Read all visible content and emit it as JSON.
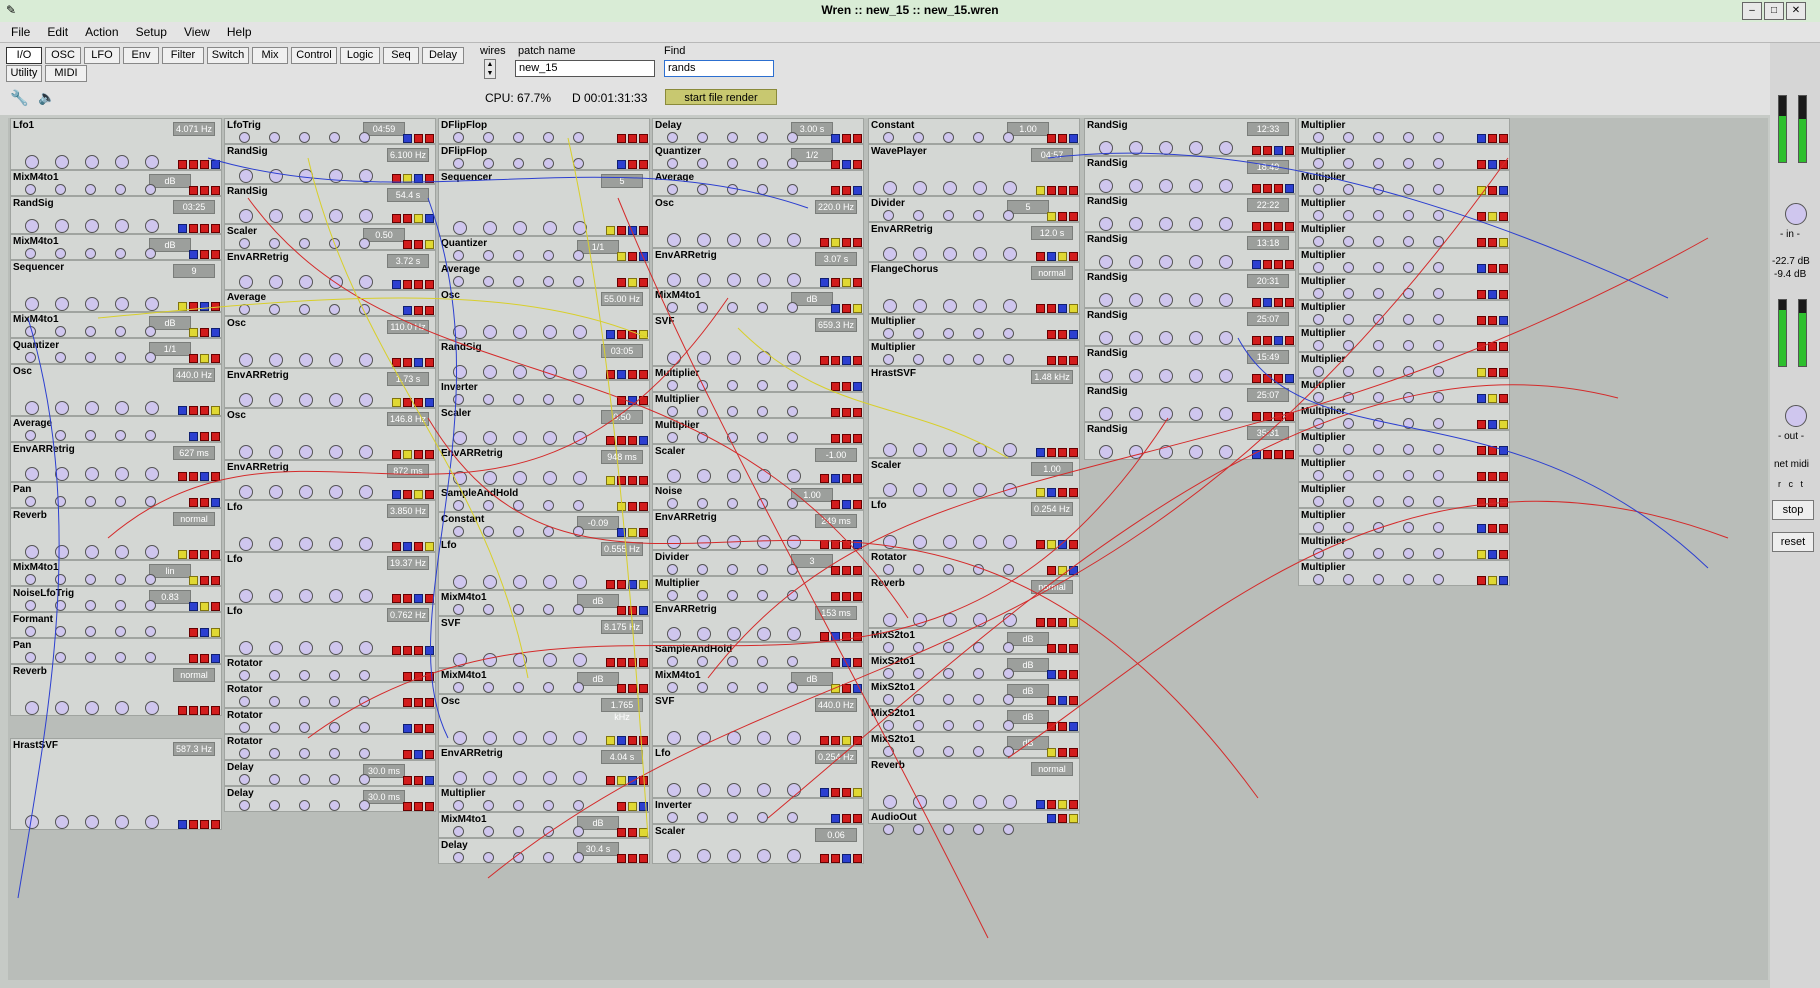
{
  "window": {
    "title": "Wren :: new_15 :: new_15.wren"
  },
  "menu": [
    "File",
    "Edit",
    "Action",
    "Setup",
    "View",
    "Help"
  ],
  "tabs_row1": [
    "I/O",
    "OSC",
    "LFO",
    "Env",
    "Filter",
    "Switch",
    "Mix",
    "Control",
    "Logic",
    "Seq",
    "Delay"
  ],
  "tabs_row2": [
    "Utility",
    "MIDI"
  ],
  "wires_label": "wires",
  "patch": {
    "label": "patch name",
    "value": "new_15"
  },
  "find": {
    "label": "Find",
    "value": "rands"
  },
  "status": {
    "cpu": "CPU: 67.7%",
    "time": "D 00:01:31:33"
  },
  "render_button": "start file render",
  "side": {
    "in_label": "- in -",
    "level1": "-22.7 dB",
    "level2": "-9.4 dB",
    "out_label": "- out -",
    "midi_label": "net midi",
    "midi_cols": "r   c   t",
    "stop": "stop",
    "reset": "reset"
  },
  "modules": [
    {
      "id": "m1",
      "name": "Lfo1",
      "disp": "4.071 Hz"
    },
    {
      "id": "m2",
      "name": "MixM4to1",
      "disp": "dB"
    },
    {
      "id": "m3",
      "name": "RandSig",
      "disp": "03:25"
    },
    {
      "id": "m4",
      "name": "MixM4to1",
      "disp": "dB"
    },
    {
      "id": "m5",
      "name": "Sequencer",
      "disp": "9"
    },
    {
      "id": "m6",
      "name": "MixM4to1",
      "disp": "dB"
    },
    {
      "id": "m7",
      "name": "Quantizer",
      "disp": "1/1"
    },
    {
      "id": "m8",
      "name": "Osc",
      "disp": "440.0 Hz"
    },
    {
      "id": "m9",
      "name": "Average",
      "disp": ""
    },
    {
      "id": "m10",
      "name": "EnvARRetrig",
      "disp": "627 ms"
    },
    {
      "id": "m11",
      "name": "Pan",
      "disp": ""
    },
    {
      "id": "m12",
      "name": "Reverb",
      "disp": "normal"
    },
    {
      "id": "m13",
      "name": "MixM4to1",
      "disp": "lin"
    },
    {
      "id": "m14",
      "name": "NoiseLfoTrig",
      "disp": "0.83"
    },
    {
      "id": "m15",
      "name": "Formant",
      "disp": ""
    },
    {
      "id": "m16",
      "name": "Pan",
      "disp": ""
    },
    {
      "id": "m17",
      "name": "Reverb",
      "disp": "normal"
    },
    {
      "id": "m18",
      "name": "HrastSVF",
      "disp": "587.3 Hz"
    },
    {
      "id": "c2a",
      "name": "LfoTrig",
      "disp": "04:59"
    },
    {
      "id": "c2b",
      "name": "RandSig",
      "disp": "6.100 Hz"
    },
    {
      "id": "c2c",
      "name": "RandSig",
      "disp": "54.4 s"
    },
    {
      "id": "c2d",
      "name": "Scaler",
      "disp": "0.50"
    },
    {
      "id": "c2e",
      "name": "EnvARRetrig",
      "disp": "3.72 s"
    },
    {
      "id": "c2f",
      "name": "Average",
      "disp": ""
    },
    {
      "id": "c2g",
      "name": "Osc",
      "disp": "110.0 Hz"
    },
    {
      "id": "c2h",
      "name": "EnvARRetrig",
      "disp": "1.73 s"
    },
    {
      "id": "c2i",
      "name": "Osc",
      "disp": "146.8 Hz"
    },
    {
      "id": "c2j",
      "name": "EnvARRetrig",
      "disp": "872 ms"
    },
    {
      "id": "c2k",
      "name": "Lfo",
      "disp": "3.850 Hz"
    },
    {
      "id": "c2l",
      "name": "Lfo",
      "disp": "19.37 Hz"
    },
    {
      "id": "c2m",
      "name": "Lfo",
      "disp": "0.762 Hz"
    },
    {
      "id": "c2n",
      "name": "Rotator",
      "disp": ""
    },
    {
      "id": "c2o",
      "name": "Rotator",
      "disp": ""
    },
    {
      "id": "c2p",
      "name": "Rotator",
      "disp": ""
    },
    {
      "id": "c2q",
      "name": "Rotator",
      "disp": ""
    },
    {
      "id": "c2r",
      "name": "Delay",
      "disp": "30.0 ms"
    },
    {
      "id": "c2s",
      "name": "Delay",
      "disp": "30.0 ms"
    },
    {
      "id": "c3a",
      "name": "DFlipFlop",
      "disp": ""
    },
    {
      "id": "c3b",
      "name": "DFlipFlop",
      "disp": ""
    },
    {
      "id": "c3c",
      "name": "Sequencer",
      "disp": "5"
    },
    {
      "id": "c3d",
      "name": "Quantizer",
      "disp": "1/1"
    },
    {
      "id": "c3e",
      "name": "Average",
      "disp": ""
    },
    {
      "id": "c3f",
      "name": "Osc",
      "disp": "55.00 Hz"
    },
    {
      "id": "c3g",
      "name": "RandSig",
      "disp": "03:05"
    },
    {
      "id": "c3h",
      "name": "Inverter",
      "disp": ""
    },
    {
      "id": "c3i",
      "name": "Scaler",
      "disp": "0.50"
    },
    {
      "id": "c3j",
      "name": "EnvARRetrig",
      "disp": "948 ms"
    },
    {
      "id": "c3k",
      "name": "SampleAndHold",
      "disp": ""
    },
    {
      "id": "c3l",
      "name": "Constant",
      "disp": "-0.09"
    },
    {
      "id": "c3m",
      "name": "Lfo",
      "disp": "0.555 Hz"
    },
    {
      "id": "c3n",
      "name": "MixM4to1",
      "disp": "dB"
    },
    {
      "id": "c3o",
      "name": "SVF",
      "disp": "8.175 Hz"
    },
    {
      "id": "c3p",
      "name": "MixM4to1",
      "disp": "dB"
    },
    {
      "id": "c3q",
      "name": "Osc",
      "disp": "1.765 kHz"
    },
    {
      "id": "c3r",
      "name": "EnvARRetrig",
      "disp": "4.04 s"
    },
    {
      "id": "c3s",
      "name": "Multiplier",
      "disp": ""
    },
    {
      "id": "c3t",
      "name": "MixM4to1",
      "disp": "dB"
    },
    {
      "id": "c3u",
      "name": "Delay",
      "disp": "30.4 s"
    },
    {
      "id": "c4a",
      "name": "Delay",
      "disp": "3.00 s"
    },
    {
      "id": "c4b",
      "name": "Quantizer",
      "disp": "1/2"
    },
    {
      "id": "c4c",
      "name": "Average",
      "disp": ""
    },
    {
      "id": "c4d",
      "name": "Osc",
      "disp": "220.0 Hz"
    },
    {
      "id": "c4e",
      "name": "EnvARRetrig",
      "disp": "3.07 s"
    },
    {
      "id": "c4f",
      "name": "MixM4to1",
      "disp": "dB"
    },
    {
      "id": "c4g",
      "name": "SVF",
      "disp": "659.3 Hz"
    },
    {
      "id": "c4h",
      "name": "Multiplier",
      "disp": ""
    },
    {
      "id": "c4i",
      "name": "Multiplier",
      "disp": ""
    },
    {
      "id": "c4j",
      "name": "Multiplier",
      "disp": ""
    },
    {
      "id": "c4k",
      "name": "Scaler",
      "disp": "-1.00"
    },
    {
      "id": "c4l",
      "name": "Noise",
      "disp": "1.00"
    },
    {
      "id": "c4m",
      "name": "EnvARRetrig",
      "disp": "249 ms"
    },
    {
      "id": "c4n",
      "name": "Divider",
      "disp": "3"
    },
    {
      "id": "c4o",
      "name": "Multiplier",
      "disp": ""
    },
    {
      "id": "c4p",
      "name": "EnvARRetrig",
      "disp": "153 ms"
    },
    {
      "id": "c4q",
      "name": "SampleAndHold",
      "disp": ""
    },
    {
      "id": "c4r",
      "name": "MixM4to1",
      "disp": "dB"
    },
    {
      "id": "c4s",
      "name": "SVF",
      "disp": "440.0 Hz"
    },
    {
      "id": "c4t",
      "name": "Lfo",
      "disp": "0.254 Hz"
    },
    {
      "id": "c4u",
      "name": "Inverter",
      "disp": ""
    },
    {
      "id": "c4v",
      "name": "Scaler",
      "disp": "0.06"
    },
    {
      "id": "c5a",
      "name": "Constant",
      "disp": "1.00"
    },
    {
      "id": "c5b",
      "name": "WavePlayer",
      "disp": "04:57"
    },
    {
      "id": "c5c",
      "name": "Divider",
      "disp": "5"
    },
    {
      "id": "c5d",
      "name": "EnvARRetrig",
      "disp": "12.0 s"
    },
    {
      "id": "c5e",
      "name": "FlangeChorus",
      "disp": "normal"
    },
    {
      "id": "c5f",
      "name": "Multiplier",
      "disp": ""
    },
    {
      "id": "c5g",
      "name": "Multiplier",
      "disp": ""
    },
    {
      "id": "c5h",
      "name": "HrastSVF",
      "disp": "1.48 kHz"
    },
    {
      "id": "c5i",
      "name": "Scaler",
      "disp": "1.00"
    },
    {
      "id": "c5j",
      "name": "Lfo",
      "disp": "0.254 Hz"
    },
    {
      "id": "c5k",
      "name": "Rotator",
      "disp": ""
    },
    {
      "id": "c5l",
      "name": "Reverb",
      "disp": "normal"
    },
    {
      "id": "c5m",
      "name": "MixS2to1",
      "disp": "dB"
    },
    {
      "id": "c5n",
      "name": "MixS2to1",
      "disp": "dB"
    },
    {
      "id": "c5o",
      "name": "MixS2to1",
      "disp": "dB"
    },
    {
      "id": "c5p",
      "name": "MixS2to1",
      "disp": "dB"
    },
    {
      "id": "c5q",
      "name": "MixS2to1",
      "disp": "dB"
    },
    {
      "id": "c5r",
      "name": "Reverb",
      "disp": "normal"
    },
    {
      "id": "c5s",
      "name": "AudioOut",
      "disp": ""
    },
    {
      "id": "c6a",
      "name": "RandSig",
      "disp": "12:33"
    },
    {
      "id": "c6b",
      "name": "RandSig",
      "disp": "18:49"
    },
    {
      "id": "c6c",
      "name": "RandSig",
      "disp": "22:22"
    },
    {
      "id": "c6d",
      "name": "RandSig",
      "disp": "13:18"
    },
    {
      "id": "c6e",
      "name": "RandSig",
      "disp": "20:31"
    },
    {
      "id": "c6f",
      "name": "RandSig",
      "disp": "25:07"
    },
    {
      "id": "c6g",
      "name": "RandSig",
      "disp": "15:49"
    },
    {
      "id": "c6h",
      "name": "RandSig",
      "disp": "25:07"
    },
    {
      "id": "c6i",
      "name": "RandSig",
      "disp": "35:31"
    },
    {
      "id": "c7a",
      "name": "Multiplier",
      "disp": ""
    },
    {
      "id": "c7b",
      "name": "Multiplier",
      "disp": ""
    },
    {
      "id": "c7c",
      "name": "Multiplier",
      "disp": ""
    },
    {
      "id": "c7d",
      "name": "Multiplier",
      "disp": ""
    },
    {
      "id": "c7e",
      "name": "Multiplier",
      "disp": ""
    },
    {
      "id": "c7f",
      "name": "Multiplier",
      "disp": ""
    },
    {
      "id": "c7g",
      "name": "Multiplier",
      "disp": ""
    },
    {
      "id": "c7h",
      "name": "Multiplier",
      "disp": ""
    },
    {
      "id": "c7i",
      "name": "Multiplier",
      "disp": ""
    },
    {
      "id": "c7j",
      "name": "Multiplier",
      "disp": ""
    },
    {
      "id": "c7k",
      "name": "Multiplier",
      "disp": ""
    },
    {
      "id": "c7l",
      "name": "Multiplier",
      "disp": ""
    },
    {
      "id": "c7m",
      "name": "Multiplier",
      "disp": ""
    },
    {
      "id": "c7n",
      "name": "Multiplier",
      "disp": ""
    },
    {
      "id": "c7o",
      "name": "Multiplier",
      "disp": ""
    },
    {
      "id": "c7p",
      "name": "Multiplier",
      "disp": ""
    },
    {
      "id": "c7q",
      "name": "Multiplier",
      "disp": ""
    },
    {
      "id": "c7r",
      "name": "Multiplier",
      "disp": ""
    }
  ],
  "wav_file": "tcp_d2_17_english_man_indial.wav"
}
